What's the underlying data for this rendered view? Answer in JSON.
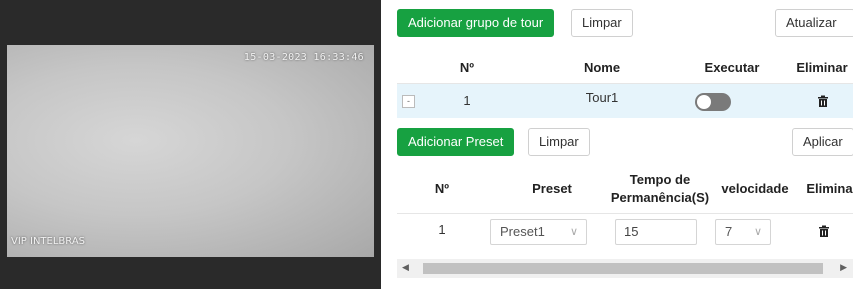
{
  "video": {
    "timestamp": "15-03-2023 16:33:46",
    "camera_label": "VIP INTELBRAS"
  },
  "tour": {
    "add_label": "Adicionar grupo de tour",
    "clear_label": "Limpar",
    "refresh_label": "Atualizar",
    "columns": [
      "Nº",
      "Nome",
      "Executar",
      "Eliminar"
    ],
    "rows": [
      {
        "expand": "-",
        "number": "1",
        "name": "Tour1",
        "execute_on": false
      }
    ]
  },
  "preset": {
    "add_label": "Adicionar Preset",
    "clear_label": "Limpar",
    "apply_label": "Aplicar",
    "columns": [
      "Nº",
      "Preset",
      "Tempo de",
      "Permanência(S)",
      "velocidade",
      "Eliminar"
    ],
    "rows": [
      {
        "number": "1",
        "preset": "Preset1",
        "dwell": "15",
        "speed": "7"
      }
    ]
  },
  "colors": {
    "accent": "#17a141",
    "row_highlight": "#e6f4fb"
  },
  "icons": {
    "delete": "trash-icon",
    "select": "chevron-down-icon"
  }
}
